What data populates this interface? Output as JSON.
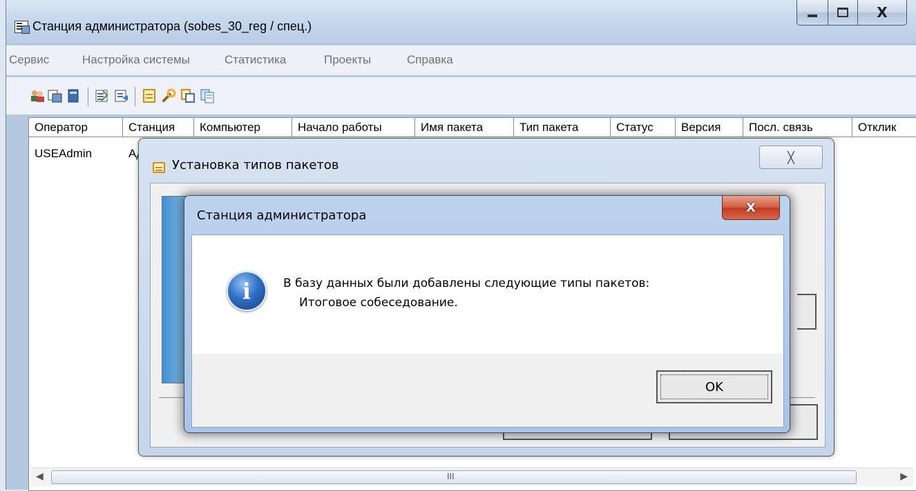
{
  "window": {
    "title": "Станция администратора (sobes_30_reg / спец.)",
    "close_glyph": "X"
  },
  "menu": {
    "items": [
      "Сервис",
      "Настройка системы",
      "Статистика",
      "Проекты",
      "Справка"
    ]
  },
  "toolbar": {
    "icons": [
      "users-icon",
      "station-icon",
      "book-icon",
      "checklist-icon",
      "export-icon",
      "package-icon",
      "wrench-icon",
      "import-icon",
      "copy-icon"
    ]
  },
  "table": {
    "columns": [
      "Оператор",
      "Станция",
      "Компьютер",
      "Начало работы",
      "Имя пакета",
      "Тип пакета",
      "Статус",
      "Версия",
      "Посл. связь",
      "Отклик"
    ],
    "rows": [
      {
        "operator": "USEAdmin",
        "station": "Ад"
      }
    ],
    "scroll_grip": "III"
  },
  "back_dialog": {
    "title": "Установка типов пакетов",
    "close_glyph": "╳"
  },
  "message_box": {
    "title": "Станция администратора",
    "close_glyph": "X",
    "icon_glyph": "i",
    "line1": "В базу данных были добавлены следующие типы пакетов:",
    "line2": "Итоговое собеседование.",
    "ok_label": "OK"
  },
  "colors": {
    "close_red": "#c23a1e",
    "info_blue": "#2f6fc6",
    "icon_orange": "#d98a1a"
  }
}
